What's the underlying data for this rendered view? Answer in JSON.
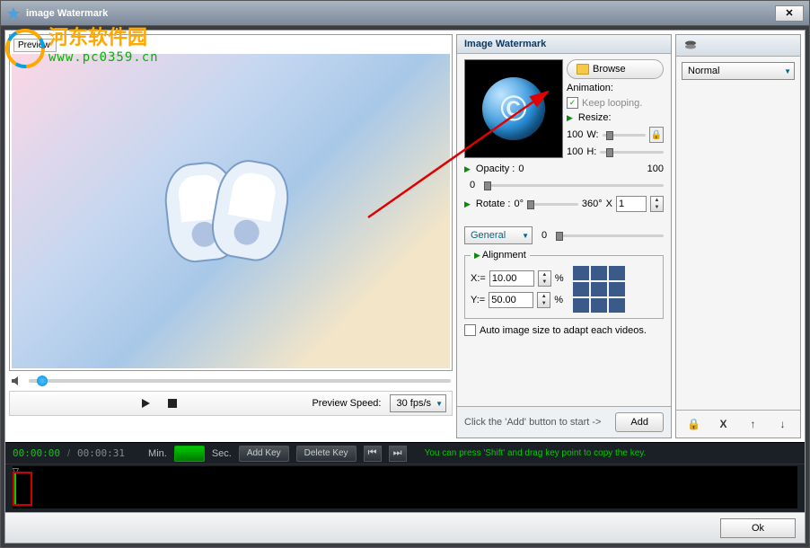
{
  "window": {
    "title": "image Watermark",
    "close": "✕"
  },
  "overlay": {
    "line1": "河东软件园",
    "line2": "www.pc0359.cn"
  },
  "preview": {
    "label": "Preview"
  },
  "volume": {
    "value": 2
  },
  "playbar": {
    "speed_label": "Preview Speed:",
    "speed_value": "30 fps/s"
  },
  "panel": {
    "title": "Image Watermark",
    "browse": "Browse",
    "animation_label": "Animation:",
    "keep_looping": "Keep looping.",
    "resize_label": "Resize:",
    "resize_w": "100",
    "w_suffix": "W:",
    "resize_h": "100",
    "h_suffix": "H:",
    "opacity_label": "Opacity :",
    "opacity_min": "0",
    "opacity_max": "100",
    "opacity_val": "0",
    "rotate_label": "Rotate :",
    "rotate_min": "0°",
    "rotate_max": "360°",
    "rotate_mult": "X",
    "rotate_times": "1",
    "effect_select": "General",
    "effect_val": "0",
    "alignment_label": "Alignment",
    "x_label": "X:=",
    "x_val": "10.00",
    "pct": "%",
    "y_label": "Y:=",
    "y_val": "50.00",
    "auto_label": "Auto image size to adapt each videos.",
    "footer_hint": "Click the 'Add' button to start ->",
    "add": "Add"
  },
  "right": {
    "mode": "Normal"
  },
  "timeline": {
    "t1": "00:00:00",
    "sep": "/",
    "t2": "00:00:31",
    "min": "Min.",
    "sec": "Sec.",
    "add_key": "Add Key",
    "del_key": "Delete Key",
    "hint": "You can press 'Shift' and drag key point to copy the key."
  },
  "footer": {
    "ok": "Ok"
  }
}
